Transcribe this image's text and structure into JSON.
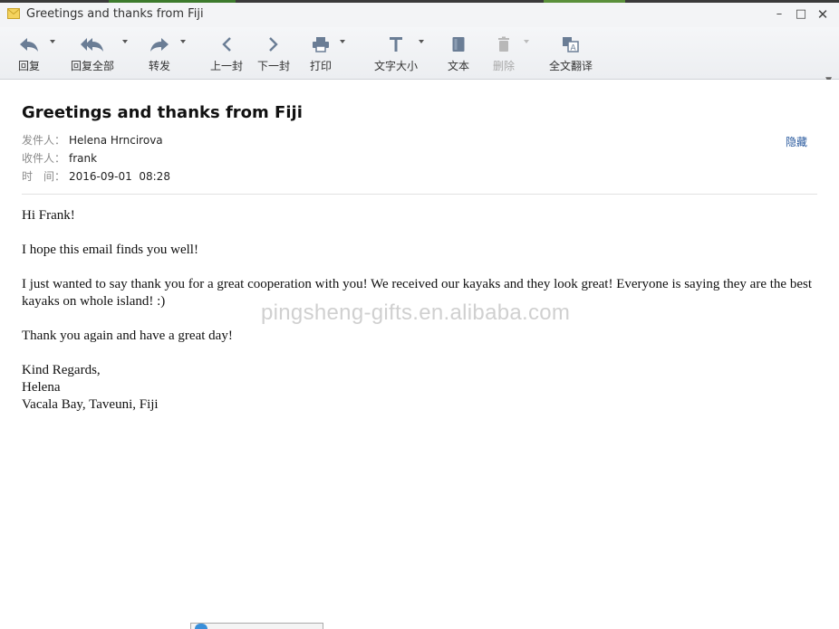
{
  "window": {
    "title": "Greetings and thanks from Fiji",
    "controls": [
      "minimize-icon",
      "maximize-icon",
      "close-icon"
    ]
  },
  "toolbar": {
    "reply": "回复",
    "reply_all": "回复全部",
    "forward": "转发",
    "prev": "上一封",
    "next": "下一封",
    "print": "打印",
    "font_size": "文字大小",
    "plain_text": "文本",
    "delete": "删除",
    "translate": "全文翻译",
    "overflow_icon": "chevron-down-icon"
  },
  "email": {
    "subject": "Greetings and thanks from Fiji",
    "from_label": "发件人：",
    "from": "Helena Hrncirova",
    "to_label": "收件人：",
    "to": "frank",
    "time_label": "时　间：",
    "time": "2016-09-01  08:28",
    "hide_link": "隐藏",
    "body": {
      "greeting": "Hi Frank!",
      "p1": "I hope this email finds you well!",
      "p2": "I just wanted to say thank you for a great cooperation with you! We received our kayaks and they look great! Everyone is saying they are the best kayaks on whole island! :)",
      "p3": "Thank you again and have a great day!",
      "sig1": "Kind Regards,",
      "sig2": "Helena",
      "sig3": "Vacala Bay, Taveuni, Fiji"
    }
  },
  "watermark": "pingsheng-gifts.en.alibaba.com",
  "colors": {
    "icon": "#6a7d95",
    "link": "#2a5a9e",
    "disabled": "#b8b8b8"
  }
}
